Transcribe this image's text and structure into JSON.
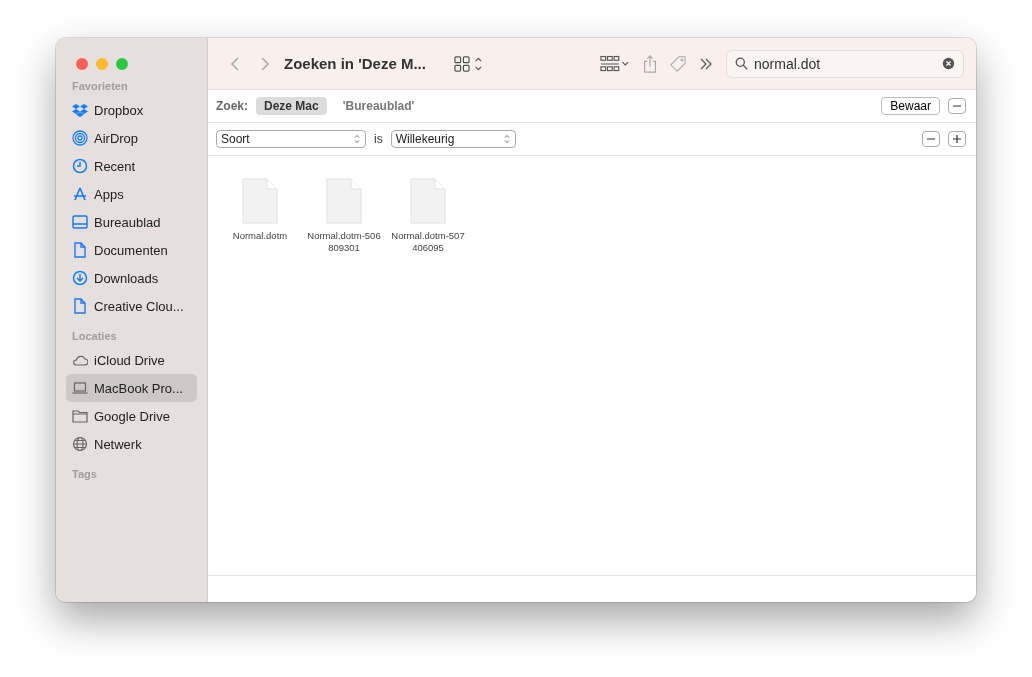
{
  "window": {
    "title": "Zoeken in 'Deze M..."
  },
  "sidebar": {
    "sections": [
      {
        "heading": "Favorieten",
        "items": [
          {
            "label": "Dropbox",
            "kind": "dropbox",
            "selected": false
          },
          {
            "label": "AirDrop",
            "kind": "airdrop",
            "selected": false
          },
          {
            "label": "Recent",
            "kind": "clock",
            "selected": false
          },
          {
            "label": "Apps",
            "kind": "apps",
            "selected": false
          },
          {
            "label": "Bureaublad",
            "kind": "desktop",
            "selected": false
          },
          {
            "label": "Documenten",
            "kind": "doc",
            "selected": false
          },
          {
            "label": "Downloads",
            "kind": "download",
            "selected": false
          },
          {
            "label": "Creative Clou...",
            "kind": "file",
            "selected": false
          }
        ]
      },
      {
        "heading": "Locaties",
        "items": [
          {
            "label": "iCloud Drive",
            "kind": "cloud",
            "selected": false
          },
          {
            "label": "MacBook Pro...",
            "kind": "laptop",
            "selected": true
          },
          {
            "label": "Google Drive",
            "kind": "folder",
            "selected": false
          },
          {
            "label": "Netwerk",
            "kind": "globe",
            "selected": false
          }
        ]
      },
      {
        "heading": "Tags"
      }
    ]
  },
  "search": {
    "value": "normal.dot"
  },
  "scope": {
    "label": "Zoek:",
    "options": [
      {
        "label": "Deze Mac",
        "selected": true
      },
      {
        "label": "'Bureaublad'",
        "selected": false
      }
    ],
    "save_button": "Bewaar"
  },
  "criteria": {
    "attribute": "Soort",
    "operator": "is",
    "value": "Willekeurig"
  },
  "files": [
    {
      "name_lines": [
        "Normal.dotm"
      ]
    },
    {
      "name_lines": [
        "Normal.dotm-506",
        "809301"
      ]
    },
    {
      "name_lines": [
        "Normal.dotm-507",
        "406095"
      ]
    }
  ]
}
